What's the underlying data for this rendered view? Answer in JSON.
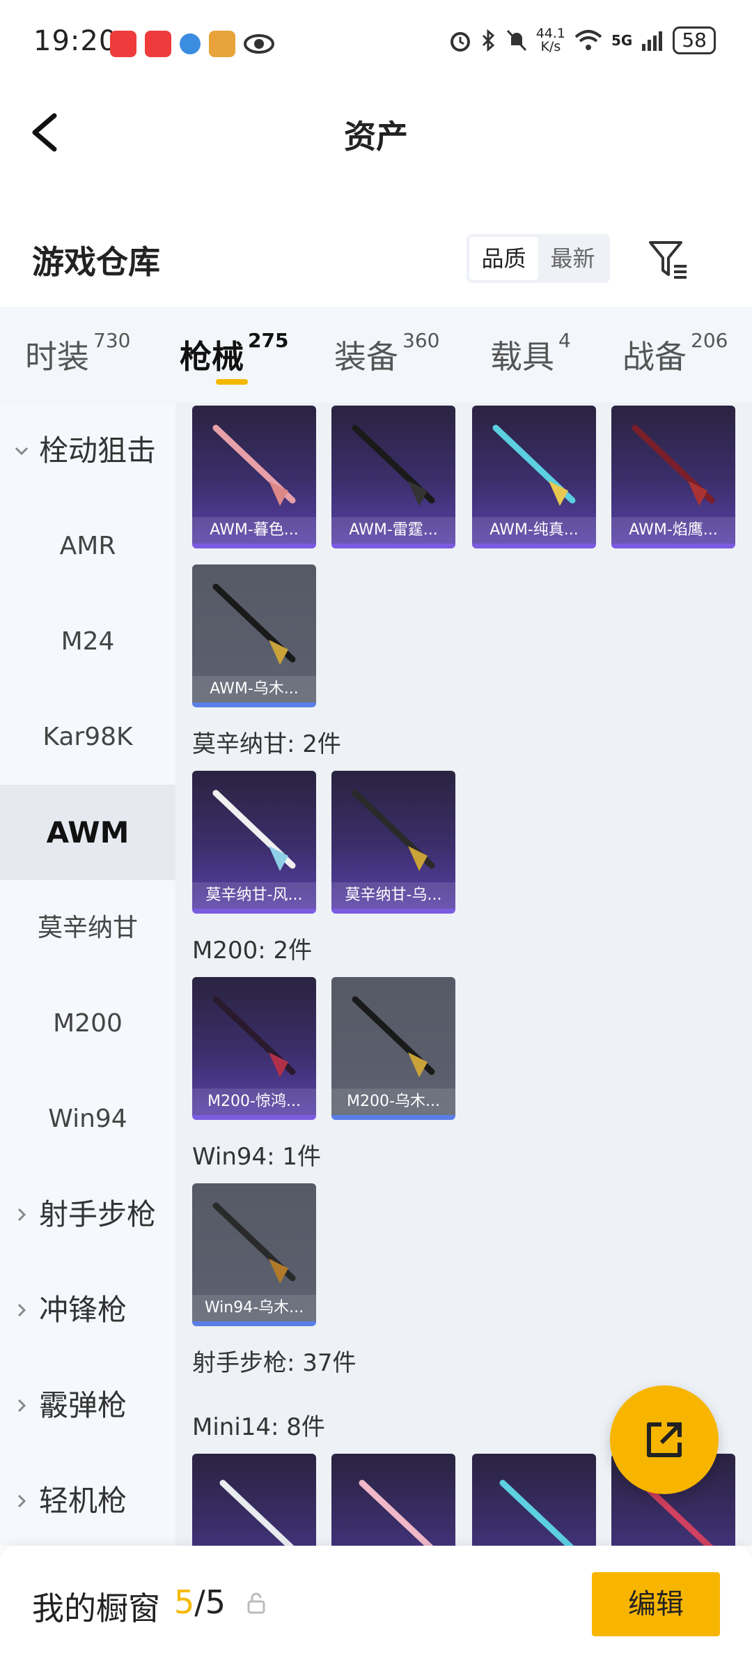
{
  "status": {
    "time": "19:20",
    "net_speed_value": "44.1",
    "net_speed_unit": "K/s",
    "network": "5G",
    "battery": "58",
    "app_colors": [
      "#ef3b3b",
      "#ef3b3b",
      "#3a8de0",
      "#e8a33a"
    ]
  },
  "header": {
    "title": "资产"
  },
  "warehouse": {
    "title": "游戏仓库",
    "sort_options": [
      "品质",
      "最新"
    ],
    "sort_selected": "品质"
  },
  "tabs": [
    {
      "label": "时装",
      "count": "730"
    },
    {
      "label": "枪械",
      "count": "275"
    },
    {
      "label": "装备",
      "count": "360"
    },
    {
      "label": "载具",
      "count": "4"
    },
    {
      "label": "战备",
      "count": "206"
    }
  ],
  "active_tab": "枪械",
  "sidebar": {
    "items": [
      {
        "label": "栓动狙击",
        "type": "category",
        "expanded": true
      },
      {
        "label": "AMR",
        "type": "sub"
      },
      {
        "label": "M24",
        "type": "sub"
      },
      {
        "label": "Kar98K",
        "type": "sub"
      },
      {
        "label": "AWM",
        "type": "sub",
        "active": true
      },
      {
        "label": "莫辛纳甘",
        "type": "sub"
      },
      {
        "label": "M200",
        "type": "sub"
      },
      {
        "label": "Win94",
        "type": "sub"
      },
      {
        "label": "射手步枪",
        "type": "category",
        "expanded": false
      },
      {
        "label": "冲锋枪",
        "type": "category",
        "expanded": false
      },
      {
        "label": "霰弹枪",
        "type": "category",
        "expanded": false
      },
      {
        "label": "轻机枪",
        "type": "category",
        "expanded": false
      }
    ]
  },
  "content": {
    "awm_items": [
      "AWM-暮色...",
      "AWM-雷霆...",
      "AWM-纯真...",
      "AWM-焰鹰...",
      "AWM-乌木..."
    ],
    "mosin_title": "莫辛纳甘: 2件",
    "mosin_items": [
      "莫辛纳甘-风...",
      "莫辛纳甘-乌..."
    ],
    "m200_title": "M200: 2件",
    "m200_items": [
      "M200-惊鸿...",
      "M200-乌木..."
    ],
    "win94_title": "Win94: 1件",
    "win94_items": [
      "Win94-乌木..."
    ],
    "marksman_title": "射手步枪: 37件",
    "mini14_title": "Mini14: 8件"
  },
  "bottom": {
    "label": "我的橱窗",
    "count_current": "5",
    "count_total": "/5",
    "edit_label": "编辑"
  },
  "colors": {
    "accent": "#f7b500",
    "purple_card": "#5940a8",
    "gray_card": "#5d6170"
  }
}
